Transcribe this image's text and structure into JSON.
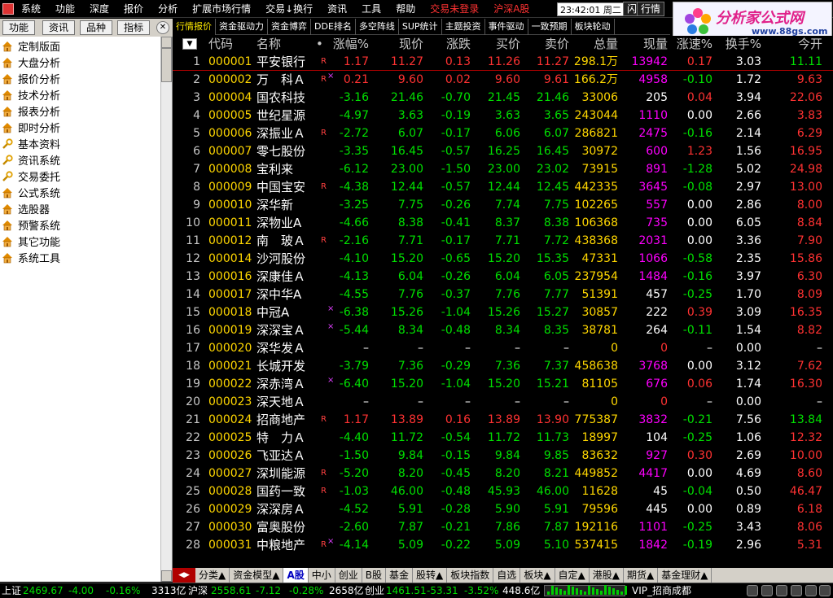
{
  "menu": {
    "items": [
      "系统",
      "功能",
      "深度",
      "报价",
      "分析",
      "扩展市场行情",
      "交易↓换行",
      "资讯",
      "工具",
      "帮助"
    ],
    "alerts": [
      "交易未登录",
      "沪深A股"
    ],
    "clock": "23:42:01 周二",
    "flash_button": "闪电手",
    "quote_button": "行情"
  },
  "logo": {
    "title": "分析家公式网",
    "url": "www.88gs.com"
  },
  "left_tabs": [
    "功能",
    "资讯",
    "品种",
    "指标"
  ],
  "sidebar": {
    "items": [
      {
        "label": "定制版面",
        "icon": "house-icon"
      },
      {
        "label": "大盘分析",
        "icon": "house-icon"
      },
      {
        "label": "报价分析",
        "icon": "house-icon"
      },
      {
        "label": "技术分析",
        "icon": "house-icon"
      },
      {
        "label": "报表分析",
        "icon": "house-icon"
      },
      {
        "label": "即时分析",
        "icon": "house-icon"
      },
      {
        "label": "基本资料",
        "icon": "wrench-icon"
      },
      {
        "label": "资讯系统",
        "icon": "wrench-icon"
      },
      {
        "label": "交易委托",
        "icon": "wrench-icon"
      },
      {
        "label": "公式系统",
        "icon": "house-icon"
      },
      {
        "label": "选股器",
        "icon": "house-icon"
      },
      {
        "label": "预警系统",
        "icon": "house-icon"
      },
      {
        "label": "其它功能",
        "icon": "house-icon"
      },
      {
        "label": "系统工具",
        "icon": "house-icon"
      }
    ]
  },
  "top_tabs": [
    "行情报价",
    "资金驱动力",
    "资金博弈",
    "DDE排名",
    "多空阵线",
    "SUP统计",
    "主题投资",
    "事件驱动",
    "一致预期",
    "板块轮动"
  ],
  "columns": [
    "代码",
    "名称",
    "•",
    "涨幅%",
    "现价",
    "涨跌",
    "买价",
    "卖价",
    "总量",
    "现量",
    "涨速%",
    "换手%",
    "今开"
  ],
  "quotes": [
    {
      "idx": "1",
      "code": "000001",
      "name": "平安银行",
      "flag": "R",
      "x": "",
      "chg_pct": "1.17",
      "price": "11.27",
      "chg": "0.13",
      "bid": "11.26",
      "ask": "11.27",
      "vol": "298.1万",
      "cur": "13942",
      "spd": "0.17",
      "turn": "3.03",
      "open": "11.11"
    },
    {
      "idx": "2",
      "code": "000002",
      "name": "万　科Ａ",
      "flag": "R",
      "x": "×",
      "chg_pct": "0.21",
      "price": "9.60",
      "chg": "0.02",
      "bid": "9.60",
      "ask": "9.61",
      "vol": "166.2万",
      "cur": "4958",
      "spd": "-0.10",
      "turn": "1.72",
      "open": "9.63"
    },
    {
      "idx": "3",
      "code": "000004",
      "name": "国农科技",
      "flag": "",
      "x": "",
      "chg_pct": "-3.16",
      "price": "21.46",
      "chg": "-0.70",
      "bid": "21.45",
      "ask": "21.46",
      "vol": "33006",
      "cur": "205",
      "spd": "0.04",
      "turn": "3.94",
      "open": "22.06"
    },
    {
      "idx": "4",
      "code": "000005",
      "name": "世纪星源",
      "flag": "",
      "x": "",
      "chg_pct": "-4.97",
      "price": "3.63",
      "chg": "-0.19",
      "bid": "3.63",
      "ask": "3.65",
      "vol": "243044",
      "cur": "1110",
      "spd": "0.00",
      "turn": "2.66",
      "open": "3.83"
    },
    {
      "idx": "5",
      "code": "000006",
      "name": "深振业Ａ",
      "flag": "R",
      "x": "",
      "chg_pct": "-2.72",
      "price": "6.07",
      "chg": "-0.17",
      "bid": "6.06",
      "ask": "6.07",
      "vol": "286821",
      "cur": "2475",
      "spd": "-0.16",
      "turn": "2.14",
      "open": "6.29"
    },
    {
      "idx": "6",
      "code": "000007",
      "name": "零七股份",
      "flag": "",
      "x": "",
      "chg_pct": "-3.35",
      "price": "16.45",
      "chg": "-0.57",
      "bid": "16.25",
      "ask": "16.45",
      "vol": "30972",
      "cur": "600",
      "spd": "1.23",
      "turn": "1.56",
      "open": "16.95"
    },
    {
      "idx": "7",
      "code": "000008",
      "name": "宝利来",
      "flag": "",
      "x": "",
      "chg_pct": "-6.12",
      "price": "23.00",
      "chg": "-1.50",
      "bid": "23.00",
      "ask": "23.02",
      "vol": "73915",
      "cur": "891",
      "spd": "-1.28",
      "turn": "5.02",
      "open": "24.98"
    },
    {
      "idx": "8",
      "code": "000009",
      "name": "中国宝安",
      "flag": "R",
      "x": "",
      "chg_pct": "-4.38",
      "price": "12.44",
      "chg": "-0.57",
      "bid": "12.44",
      "ask": "12.45",
      "vol": "442335",
      "cur": "3645",
      "spd": "-0.08",
      "turn": "2.97",
      "open": "13.00"
    },
    {
      "idx": "9",
      "code": "000010",
      "name": "深华新",
      "flag": "",
      "x": "",
      "chg_pct": "-3.25",
      "price": "7.75",
      "chg": "-0.26",
      "bid": "7.74",
      "ask": "7.75",
      "vol": "102265",
      "cur": "557",
      "spd": "0.00",
      "turn": "2.86",
      "open": "8.00"
    },
    {
      "idx": "10",
      "code": "000011",
      "name": "深物业A",
      "flag": "",
      "x": "",
      "chg_pct": "-4.66",
      "price": "8.38",
      "chg": "-0.41",
      "bid": "8.37",
      "ask": "8.38",
      "vol": "106368",
      "cur": "735",
      "spd": "0.00",
      "turn": "6.05",
      "open": "8.84"
    },
    {
      "idx": "11",
      "code": "000012",
      "name": "南　玻Ａ",
      "flag": "R",
      "x": "",
      "chg_pct": "-2.16",
      "price": "7.71",
      "chg": "-0.17",
      "bid": "7.71",
      "ask": "7.72",
      "vol": "438368",
      "cur": "2031",
      "spd": "0.00",
      "turn": "3.36",
      "open": "7.90"
    },
    {
      "idx": "12",
      "code": "000014",
      "name": "沙河股份",
      "flag": "",
      "x": "",
      "chg_pct": "-4.10",
      "price": "15.20",
      "chg": "-0.65",
      "bid": "15.20",
      "ask": "15.35",
      "vol": "47331",
      "cur": "1066",
      "spd": "-0.58",
      "turn": "2.35",
      "open": "15.86"
    },
    {
      "idx": "13",
      "code": "000016",
      "name": "深康佳Ａ",
      "flag": "",
      "x": "",
      "chg_pct": "-4.13",
      "price": "6.04",
      "chg": "-0.26",
      "bid": "6.04",
      "ask": "6.05",
      "vol": "237954",
      "cur": "1484",
      "spd": "-0.16",
      "turn": "3.97",
      "open": "6.30"
    },
    {
      "idx": "14",
      "code": "000017",
      "name": "深中华A",
      "flag": "",
      "x": "",
      "chg_pct": "-4.55",
      "price": "7.76",
      "chg": "-0.37",
      "bid": "7.76",
      "ask": "7.77",
      "vol": "51391",
      "cur": "457",
      "spd": "-0.25",
      "turn": "1.70",
      "open": "8.09"
    },
    {
      "idx": "15",
      "code": "000018",
      "name": "中冠A",
      "flag": "",
      "x": "×",
      "chg_pct": "-6.38",
      "price": "15.26",
      "chg": "-1.04",
      "bid": "15.26",
      "ask": "15.27",
      "vol": "30857",
      "cur": "222",
      "spd": "0.39",
      "turn": "3.09",
      "open": "16.35"
    },
    {
      "idx": "16",
      "code": "000019",
      "name": "深深宝Ａ",
      "flag": "",
      "x": "×",
      "chg_pct": "-5.44",
      "price": "8.34",
      "chg": "-0.48",
      "bid": "8.34",
      "ask": "8.35",
      "vol": "38781",
      "cur": "264",
      "spd": "-0.11",
      "turn": "1.54",
      "open": "8.82"
    },
    {
      "idx": "17",
      "code": "000020",
      "name": "深华发Ａ",
      "flag": "",
      "x": "",
      "chg_pct": "–",
      "price": "–",
      "chg": "–",
      "bid": "–",
      "ask": "–",
      "vol": "0",
      "cur": "0",
      "spd": "–",
      "turn": "0.00",
      "open": "–"
    },
    {
      "idx": "18",
      "code": "000021",
      "name": "长城开发",
      "flag": "",
      "x": "",
      "chg_pct": "-3.79",
      "price": "7.36",
      "chg": "-0.29",
      "bid": "7.36",
      "ask": "7.37",
      "vol": "458638",
      "cur": "3768",
      "spd": "0.00",
      "turn": "3.12",
      "open": "7.62"
    },
    {
      "idx": "19",
      "code": "000022",
      "name": "深赤湾Ａ",
      "flag": "",
      "x": "×",
      "chg_pct": "-6.40",
      "price": "15.20",
      "chg": "-1.04",
      "bid": "15.20",
      "ask": "15.21",
      "vol": "81105",
      "cur": "676",
      "spd": "0.06",
      "turn": "1.74",
      "open": "16.30"
    },
    {
      "idx": "20",
      "code": "000023",
      "name": "深天地Ａ",
      "flag": "",
      "x": "",
      "chg_pct": "–",
      "price": "–",
      "chg": "–",
      "bid": "–",
      "ask": "–",
      "vol": "0",
      "cur": "0",
      "spd": "–",
      "turn": "0.00",
      "open": "–"
    },
    {
      "idx": "21",
      "code": "000024",
      "name": "招商地产",
      "flag": "R",
      "x": "",
      "chg_pct": "1.17",
      "price": "13.89",
      "chg": "0.16",
      "bid": "13.89",
      "ask": "13.90",
      "vol": "775387",
      "cur": "3832",
      "spd": "-0.21",
      "turn": "7.56",
      "open": "13.84"
    },
    {
      "idx": "22",
      "code": "000025",
      "name": "特　力Ａ",
      "flag": "",
      "x": "",
      "chg_pct": "-4.40",
      "price": "11.72",
      "chg": "-0.54",
      "bid": "11.72",
      "ask": "11.73",
      "vol": "18997",
      "cur": "104",
      "spd": "-0.25",
      "turn": "1.06",
      "open": "12.32"
    },
    {
      "idx": "23",
      "code": "000026",
      "name": "飞亚达Ａ",
      "flag": "",
      "x": "",
      "chg_pct": "-1.50",
      "price": "9.84",
      "chg": "-0.15",
      "bid": "9.84",
      "ask": "9.85",
      "vol": "83632",
      "cur": "927",
      "spd": "0.30",
      "turn": "2.69",
      "open": "10.00"
    },
    {
      "idx": "24",
      "code": "000027",
      "name": "深圳能源",
      "flag": "R",
      "x": "",
      "chg_pct": "-5.20",
      "price": "8.20",
      "chg": "-0.45",
      "bid": "8.20",
      "ask": "8.21",
      "vol": "449852",
      "cur": "4417",
      "spd": "0.00",
      "turn": "4.69",
      "open": "8.60"
    },
    {
      "idx": "25",
      "code": "000028",
      "name": "国药一致",
      "flag": "R",
      "x": "",
      "chg_pct": "-1.03",
      "price": "46.00",
      "chg": "-0.48",
      "bid": "45.93",
      "ask": "46.00",
      "vol": "11628",
      "cur": "45",
      "spd": "-0.04",
      "turn": "0.50",
      "open": "46.47"
    },
    {
      "idx": "26",
      "code": "000029",
      "name": "深深房Ａ",
      "flag": "",
      "x": "",
      "chg_pct": "-4.52",
      "price": "5.91",
      "chg": "-0.28",
      "bid": "5.90",
      "ask": "5.91",
      "vol": "79596",
      "cur": "445",
      "spd": "0.00",
      "turn": "0.89",
      "open": "6.18"
    },
    {
      "idx": "27",
      "code": "000030",
      "name": "富奥股份",
      "flag": "",
      "x": "",
      "chg_pct": "-2.60",
      "price": "7.87",
      "chg": "-0.21",
      "bid": "7.86",
      "ask": "7.87",
      "vol": "192116",
      "cur": "1101",
      "spd": "-0.25",
      "turn": "3.43",
      "open": "8.06"
    },
    {
      "idx": "28",
      "code": "000031",
      "name": "中粮地产",
      "flag": "R",
      "x": "×",
      "chg_pct": "-4.14",
      "price": "5.09",
      "chg": "-0.22",
      "bid": "5.09",
      "ask": "5.10",
      "vol": "537415",
      "cur": "1842",
      "spd": "-0.19",
      "turn": "2.96",
      "open": "5.31"
    }
  ],
  "bottom_tabs": [
    "分类▲",
    "资金模型▲",
    "A股",
    "中小",
    "创业",
    "B股",
    "基金",
    "股转▲",
    "板块指数",
    "自选",
    "板块▲",
    "自定▲",
    "港股▲",
    "期货▲",
    "基金理财▲"
  ],
  "status": {
    "sh_label": "上证",
    "sh_val": "2469.67",
    "sh_chg": "-4.00",
    "sh_pct": "-0.16%",
    "sh_amt": "3313亿",
    "sz_label": "沪深",
    "sz_val": "2558.61",
    "sz_chg": "-7.12",
    "sz_pct": "-0.28%",
    "sz_amt": "2658亿",
    "cy_label": "创业",
    "cy_val": "1461.51",
    "cy_chg": "-53.31",
    "cy_pct": "-3.52%",
    "cy_amt": "448.6亿",
    "vip": "VIP_招商成都"
  },
  "colors": {
    "up": "#ff3232",
    "down": "#00e000",
    "flat": "#ffffff",
    "code": "#ffd700",
    "volume_current": "#ff00ff"
  }
}
